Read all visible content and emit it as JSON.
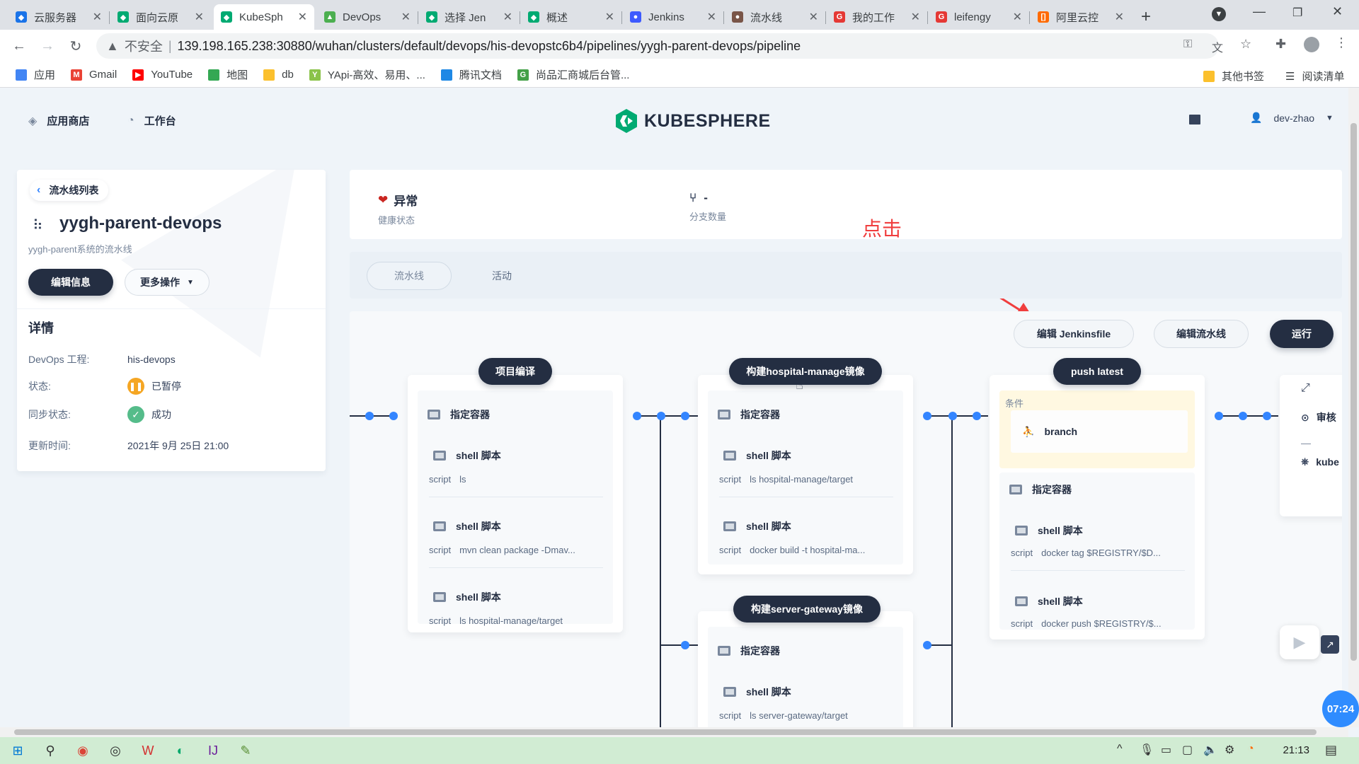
{
  "browser": {
    "tabs": [
      {
        "title": "云服务器",
        "color": "#1a73e8",
        "glyph": "◆"
      },
      {
        "title": "面向云原",
        "color": "#00aa72",
        "glyph": "◆"
      },
      {
        "title": "KubeSph",
        "color": "#00aa72",
        "glyph": "◆",
        "active": true
      },
      {
        "title": "DevOps",
        "color": "#4caf50",
        "glyph": "▲"
      },
      {
        "title": "选择 Jen",
        "color": "#00aa72",
        "glyph": "◆"
      },
      {
        "title": "概述",
        "color": "#00aa72",
        "glyph": "◆"
      },
      {
        "title": "Jenkins",
        "color": "#3d5afe",
        "glyph": "●"
      },
      {
        "title": "流水线",
        "color": "#795548",
        "glyph": "●"
      },
      {
        "title": "我的工作",
        "color": "#e53935",
        "glyph": "G"
      },
      {
        "title": "leifengy",
        "color": "#e53935",
        "glyph": "G"
      },
      {
        "title": "阿里云控",
        "color": "#ff6a00",
        "glyph": "[]"
      }
    ],
    "url": "139.198.165.238:30880/wuhan/clusters/default/devops/his-devopstc6b4/pipelines/yygh-parent-devops/pipeline",
    "insecure_label": "不安全",
    "bookmarks": [
      {
        "label": "应用",
        "color": "#4285f4"
      },
      {
        "label": "Gmail",
        "color": "#ea4335"
      },
      {
        "label": "YouTube",
        "color": "#ff0000"
      },
      {
        "label": "地图",
        "color": "#34a853"
      },
      {
        "label": "db",
        "color": "#fbc02d"
      },
      {
        "label": "YApi-高效、易用、...",
        "color": "#8bc34a"
      },
      {
        "label": "腾讯文档",
        "color": "#1e88e5"
      },
      {
        "label": "尚品汇商城后台管...",
        "color": "#43a047"
      }
    ],
    "other_bookmarks": "其他书签",
    "reading_list": "阅读清单"
  },
  "header": {
    "app_store": "应用商店",
    "workbench": "工作台",
    "logo": "KUBESPHERE",
    "user": "dev-zhao"
  },
  "left": {
    "back": "流水线列表",
    "name": "yygh-parent-devops",
    "desc": "yygh-parent系统的流水线",
    "edit": "编辑信息",
    "more": "更多操作",
    "details_title": "详情",
    "rows": [
      {
        "k": "DevOps 工程:",
        "v": "his-devops"
      },
      {
        "k": "状态:",
        "v": "已暂停"
      },
      {
        "k": "同步状态:",
        "v": "成功"
      },
      {
        "k": "更新时间:",
        "v": "2021年 9月 25日 21:00"
      }
    ]
  },
  "info": {
    "health_value": "异常",
    "health_label": "健康状态",
    "branch_value": "-",
    "branch_label": "分支数量"
  },
  "tabs": {
    "pipeline": "流水线",
    "activity": "活动"
  },
  "actions": {
    "edit_jenkinsfile": "编辑 Jenkinsfile",
    "edit_pipeline": "编辑流水线",
    "run": "运行"
  },
  "annotation": "点击",
  "stages": {
    "s1": {
      "name": "项目编译",
      "container": "指定容器",
      "steps": [
        {
          "title": "shell 脚本",
          "s": "script",
          "cmd": "ls"
        },
        {
          "title": "shell 脚本",
          "s": "script",
          "cmd": "mvn clean package -Dmav..."
        },
        {
          "title": "shell 脚本",
          "s": "script",
          "cmd": "ls hospital-manage/target"
        }
      ]
    },
    "s2a": {
      "name": "构建hospital-manage镜像",
      "container": "指定容器",
      "steps": [
        {
          "title": "shell 脚本",
          "s": "script",
          "cmd": "ls hospital-manage/target"
        },
        {
          "title": "shell 脚本",
          "s": "script",
          "cmd": "docker build -t hospital-ma..."
        }
      ]
    },
    "s2b": {
      "name": "构建server-gateway镜像",
      "container": "指定容器",
      "steps": [
        {
          "title": "shell 脚本",
          "s": "script",
          "cmd": "ls server-gateway/target"
        }
      ]
    },
    "s3": {
      "name": "push latest",
      "cond_label": "条件",
      "cond_value": "branch",
      "container": "指定容器",
      "steps": [
        {
          "title": "shell 脚本",
          "s": "script",
          "cmd": "docker tag $REGISTRY/$D..."
        },
        {
          "title": "shell 脚本",
          "s": "script",
          "cmd": "docker push $REGISTRY/$..."
        }
      ]
    },
    "s4": {
      "review": "审核",
      "kube": "kube"
    }
  },
  "taskbar": {
    "time": "21:13"
  },
  "video_timer": "07:24"
}
